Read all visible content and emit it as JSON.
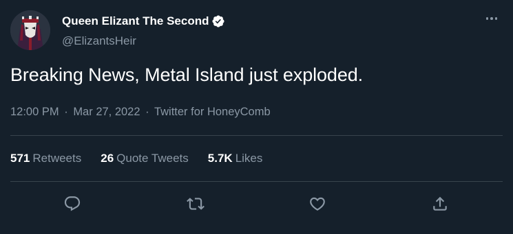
{
  "author": {
    "display_name": "Queen Elizant The Second",
    "handle": "@ElizantsHeir",
    "verified_icon": "verified-badge-icon"
  },
  "tweet": {
    "text": "Breaking News, Metal Island just exploded.",
    "time": "12:00 PM",
    "date": "Mar 27, 2022",
    "source": "Twitter for HoneyComb",
    "separator": "·"
  },
  "stats": [
    {
      "count": "571",
      "label": "Retweets"
    },
    {
      "count": "26",
      "label": "Quote Tweets"
    },
    {
      "count": "5.7K",
      "label": "Likes"
    }
  ],
  "actions": {
    "reply_icon": "reply-icon",
    "retweet_icon": "retweet-icon",
    "like_icon": "heart-icon",
    "share_icon": "share-icon"
  },
  "colors": {
    "background": "#15202b",
    "text_primary": "#ffffff",
    "text_secondary": "#8b98a5",
    "divider": "#38444d",
    "verified_badge": "#ffffff"
  }
}
